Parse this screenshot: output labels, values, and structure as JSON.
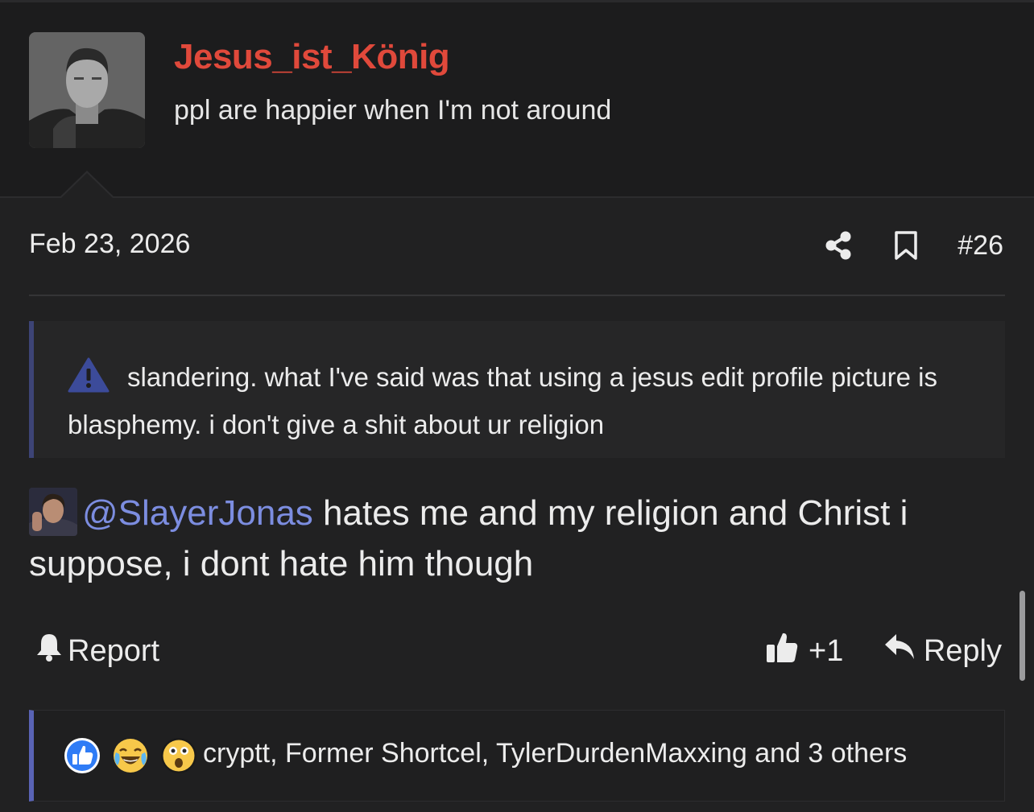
{
  "user": {
    "name": "Jesus_ist_König",
    "title": "ppl are happier when I'm not around",
    "avatar_icon": "user-avatar-photo"
  },
  "post": {
    "date": "Feb 23, 2026",
    "number": "#26",
    "share_icon": "share-icon",
    "bookmark_icon": "bookmark-icon"
  },
  "quote": {
    "icon": "warning-icon",
    "text": "slandering. what I've said was that using a jesus edit profile picture is blasphemy. i don't give a shit about ur religion"
  },
  "body": {
    "mention": "@SlayerJonas",
    "text": " hates me and my religion and Christ i suppose, i dont hate him though"
  },
  "actions": {
    "report_label": "Report",
    "like_count": "+1",
    "reply_label": "Reply"
  },
  "reactions": {
    "icons": [
      "thumbs-up-icon",
      "laughing-crying-icon",
      "shocked-face-icon"
    ],
    "text": "cryptt, Former Shortcel, TylerDurdenMaxxing and 3 others"
  },
  "colors": {
    "background": "#212122",
    "username": "#e0493b",
    "mention": "#7c8de0",
    "quote_border": "#3d4476",
    "reaction_border": "#5963b5"
  }
}
